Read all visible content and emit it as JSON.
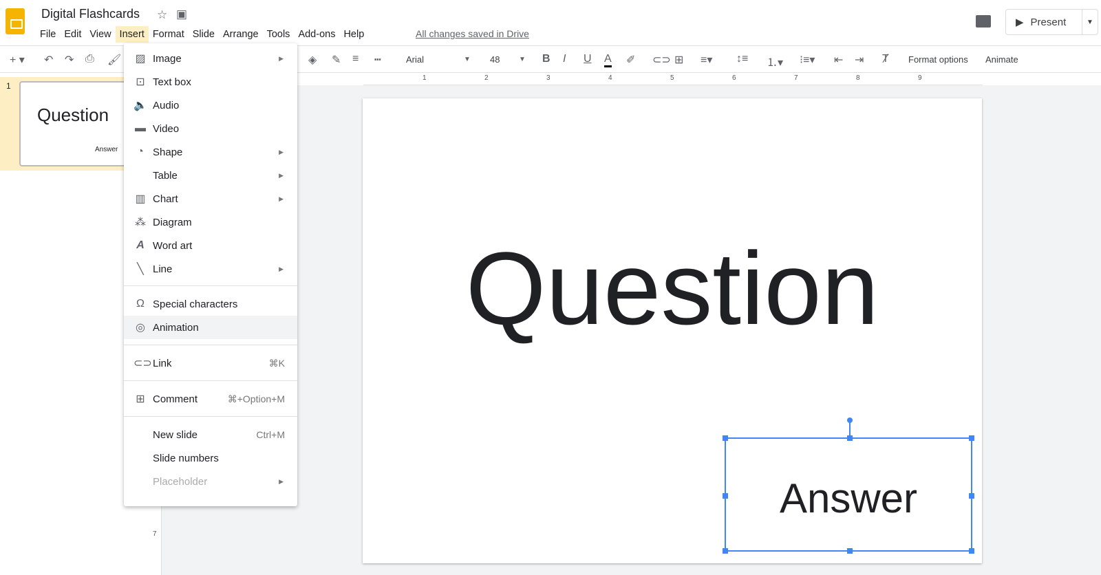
{
  "app": {
    "title": "Digital Flashcards",
    "saved_status": "All changes saved in Drive",
    "present_label": "Present"
  },
  "menubar": [
    "File",
    "Edit",
    "View",
    "Insert",
    "Format",
    "Slide",
    "Arrange",
    "Tools",
    "Add-ons",
    "Help"
  ],
  "toolbar": {
    "font": "Arial",
    "font_size": "48",
    "format_options": "Format options",
    "animate": "Animate"
  },
  "ruler": [
    "1",
    "2",
    "3",
    "4",
    "5",
    "6",
    "7",
    "8",
    "9"
  ],
  "vertical_ruler": "7",
  "filmstrip": {
    "slide_number": "1",
    "thumb_title": "Question",
    "thumb_answer": "Answer"
  },
  "slide": {
    "title": "Question",
    "answer": "Answer"
  },
  "insert_menu": [
    {
      "label": "Image",
      "icon": "image-icon",
      "submenu": true
    },
    {
      "label": "Text box",
      "icon": "text-box-icon"
    },
    {
      "label": "Audio",
      "icon": "audio-icon"
    },
    {
      "label": "Video",
      "icon": "video-icon"
    },
    {
      "label": "Shape",
      "icon": "shape-icon",
      "submenu": true
    },
    {
      "label": "Table",
      "submenu": true
    },
    {
      "label": "Chart",
      "icon": "chart-icon",
      "submenu": true
    },
    {
      "label": "Diagram",
      "icon": "diagram-icon"
    },
    {
      "label": "Word art",
      "icon": "word-art-icon"
    },
    {
      "label": "Line",
      "icon": "line-icon",
      "submenu": true
    },
    {
      "label": "Special characters",
      "icon": "omega-icon"
    },
    {
      "label": "Animation",
      "icon": "animation-icon",
      "highlighted": true
    },
    {
      "label": "Link",
      "icon": "link-icon",
      "shortcut": "⌘K"
    },
    {
      "label": "Comment",
      "icon": "comment-add-icon",
      "shortcut": "⌘+Option+M"
    },
    {
      "label": "New slide",
      "shortcut": "Ctrl+M"
    },
    {
      "label": "Slide numbers"
    },
    {
      "label": "Placeholder",
      "submenu": true,
      "disabled": true
    }
  ],
  "colors": {
    "accent": "#4285f4",
    "menu_highlight": "#fdefc3",
    "logo": "#f4b400"
  }
}
